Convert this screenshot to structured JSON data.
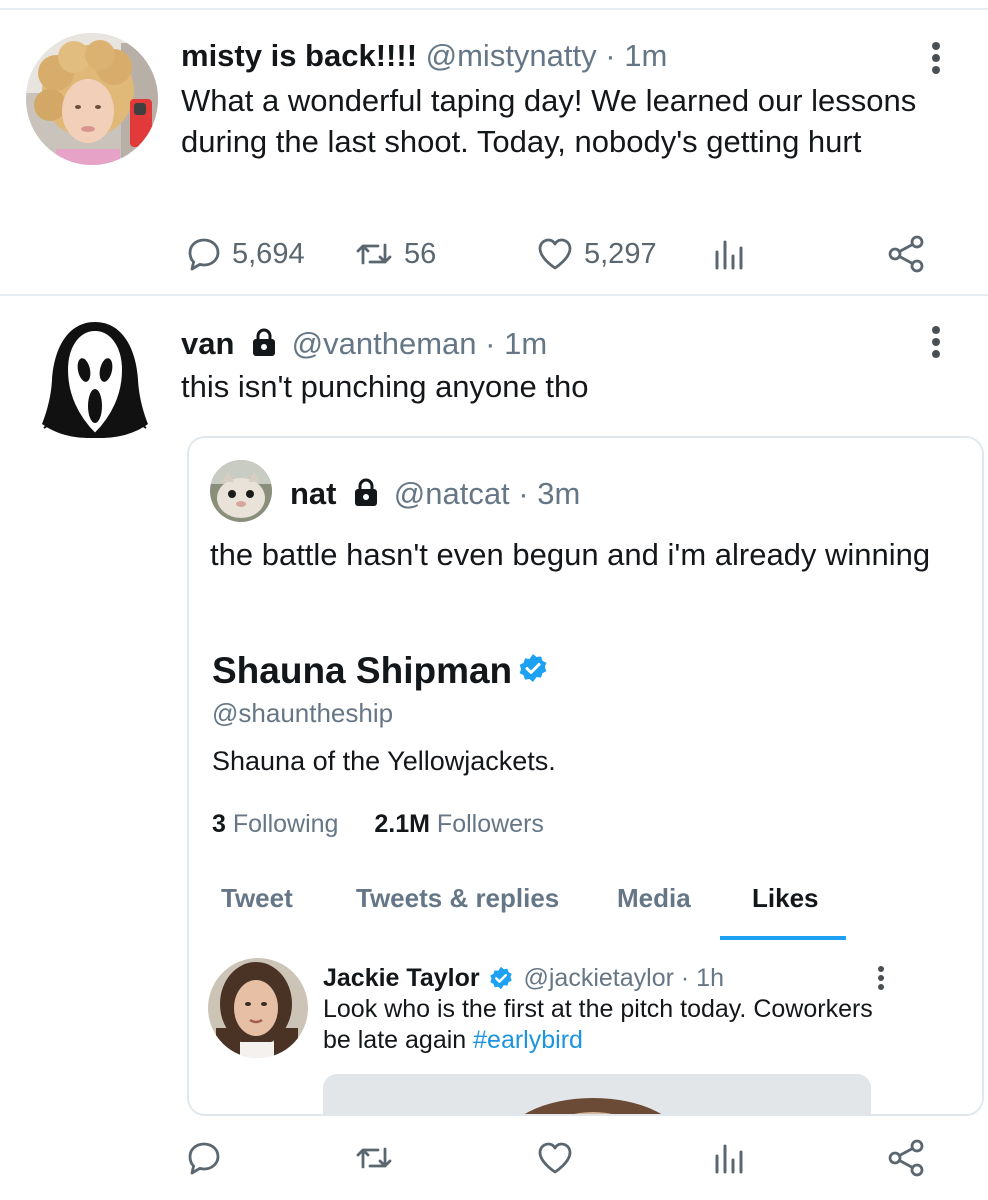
{
  "tweets": [
    {
      "display_name": "misty is back!!!!",
      "handle": "@mistynatty",
      "separator": "·",
      "time": "1m",
      "text": "What a wonderful taping day! We learned our lessons during the last shoot. Today, nobody's getting hurt",
      "replies": "5,694",
      "retweets": "56",
      "likes": "5,297",
      "avatar_icon": "curly-haired-person-avatar"
    },
    {
      "display_name": "van",
      "handle": "@vantheman",
      "separator": "·",
      "time": "1m",
      "text": "this isn't punching anyone tho",
      "locked": true,
      "avatar_icon": "ghostface-mask-avatar",
      "quote": {
        "display_name": "nat",
        "handle": "@natcat",
        "separator": "·",
        "time": "3m",
        "text": "the battle hasn't even begun and i'm already winning",
        "locked": true,
        "avatar_icon": "cat-avatar",
        "profile": {
          "name": "Shauna Shipman",
          "handle": "@shauntheship",
          "bio": "Shauna of the Yellowjackets.",
          "following_count": "3",
          "following_label": "Following",
          "followers_count": "2.1M",
          "followers_label": "Followers",
          "tabs": [
            "Tweet",
            "Tweets & replies",
            "Media",
            "Likes"
          ],
          "active_tab": "Likes"
        },
        "inner_tweet": {
          "display_name": "Jackie Taylor",
          "handle": "@jackietaylor",
          "separator": "·",
          "time": "1h",
          "text": "Look who is the first at the pitch today. Coworkers be late again",
          "hashtag": "#earlybird",
          "avatar_icon": "brunette-woman-avatar"
        }
      }
    }
  ],
  "colors": {
    "accent": "#1da1f2",
    "verified": "#1da1f2",
    "hashtag": "#1b95e0",
    "secondary_text": "#657786",
    "divider": "#e6ecf0"
  }
}
